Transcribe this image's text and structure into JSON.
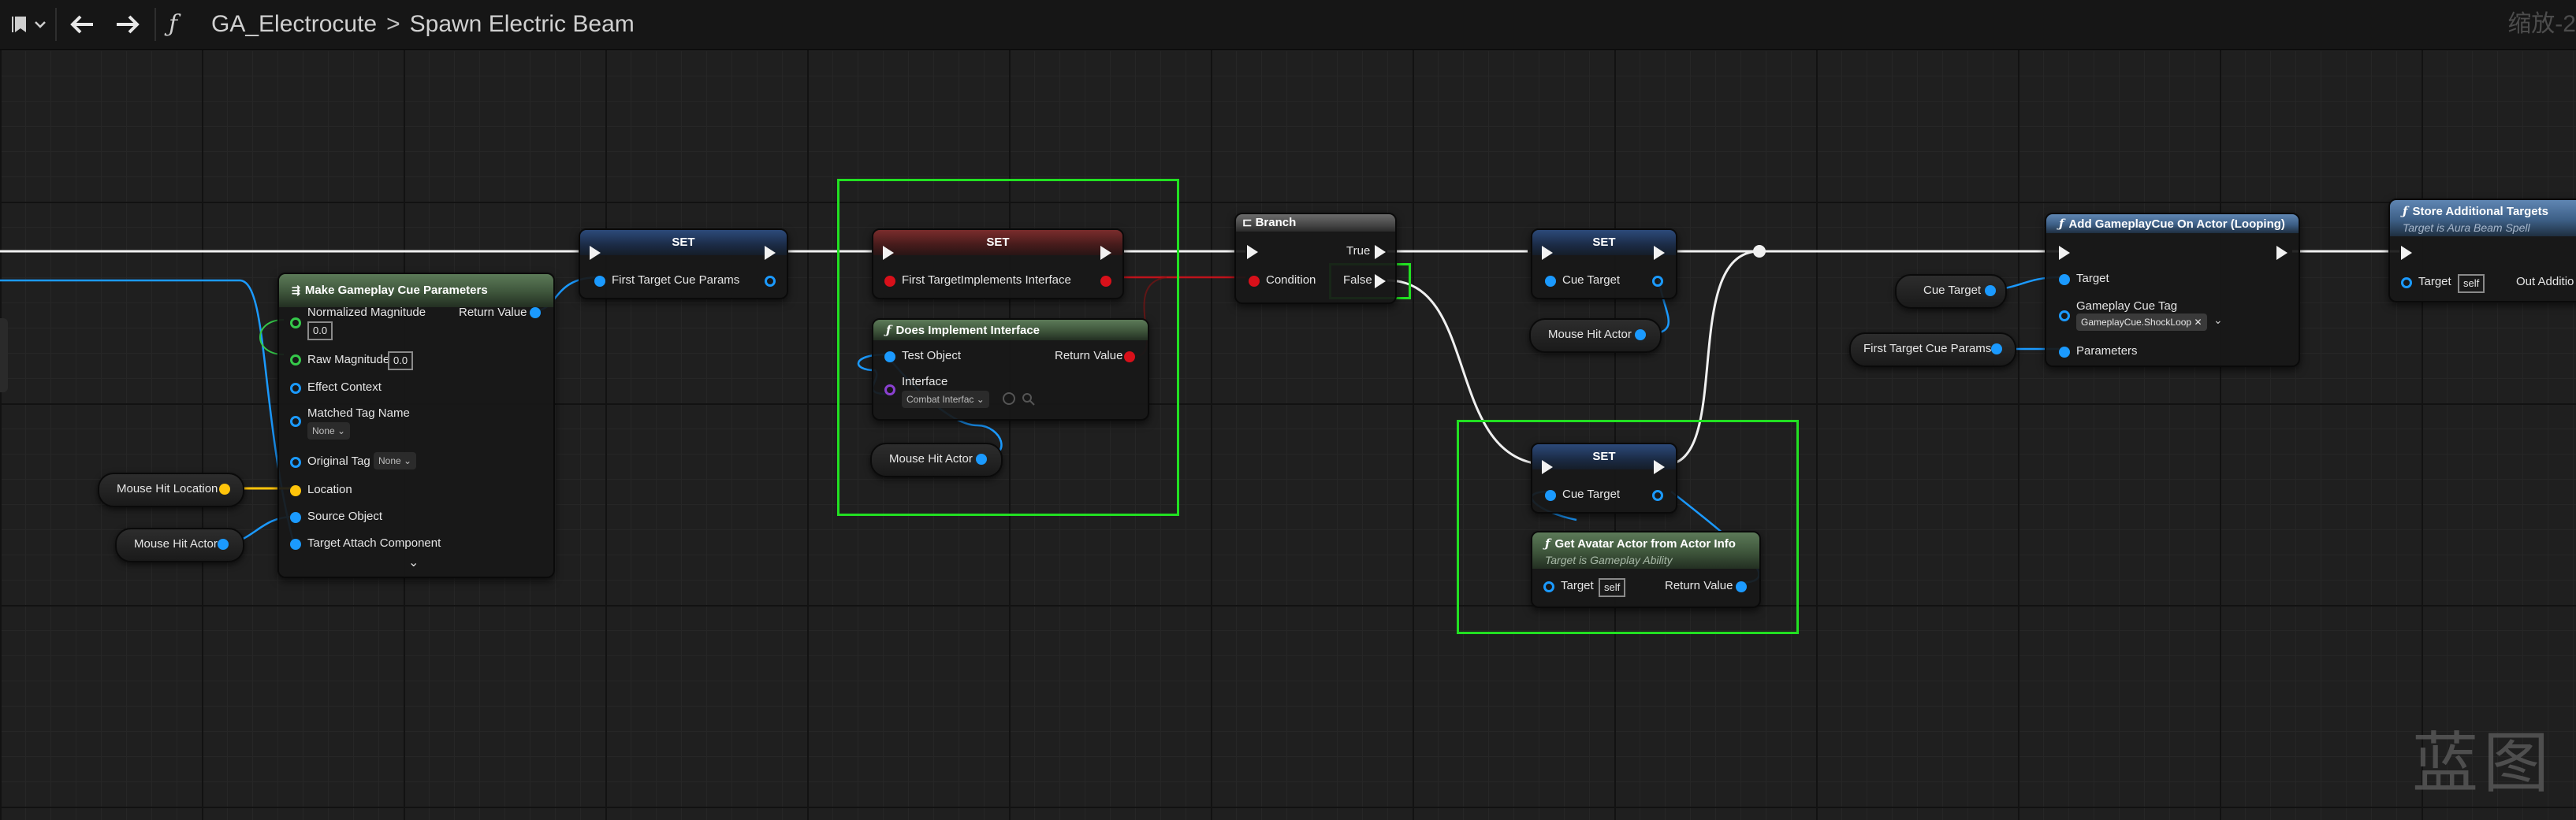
{
  "toolbar": {
    "bookmark_icon": "bookmark-icon",
    "dropdown_icon": "chevron-down-icon",
    "back_icon": "arrow-left-icon",
    "forward_icon": "arrow-right-icon",
    "function_glyph": "ƒ",
    "breadcrumb_blueprint": "GA_Electrocute",
    "breadcrumb_separator": ">",
    "breadcrumb_function": "Spawn Electric Beam",
    "zoom_label": "缩放-2"
  },
  "nodes": {
    "make_cue_params": {
      "title": "Make Gameplay Cue Parameters",
      "pins": {
        "normalized_magnitude": "Normalized Magnitude",
        "normalized_magnitude_value": "0.0",
        "return_value": "Return Value",
        "raw_magnitude": "Raw Magnitude",
        "raw_magnitude_value": "0.0",
        "effect_context": "Effect Context",
        "matched_tag_name": "Matched Tag Name",
        "matched_tag_value": "None",
        "original_tag": "Original Tag",
        "original_tag_value": "None",
        "location": "Location",
        "source_object": "Source Object",
        "target_attach": "Target Attach Component"
      }
    },
    "set_first_params": {
      "title": "SET",
      "pin": "First Target Cue Params"
    },
    "set_first_impl": {
      "title": "SET",
      "pin": "First TargetImplements Interface"
    },
    "does_impl": {
      "title": "Does Implement Interface",
      "test_object": "Test Object",
      "return_value": "Return Value",
      "interface": "Interface",
      "interface_value": "Combat Interfac"
    },
    "branch": {
      "title": "Branch",
      "true_label": "True",
      "condition": "Condition",
      "false_label": "False"
    },
    "set_cue_target_top": {
      "title": "SET",
      "pin": "Cue Target"
    },
    "set_cue_target_bottom": {
      "title": "SET",
      "pin": "Cue Target"
    },
    "get_avatar": {
      "title": "Get Avatar Actor from Actor Info",
      "subtitle": "Target is Gameplay Ability",
      "target": "Target",
      "target_value": "self",
      "return_value": "Return Value"
    },
    "add_cue": {
      "title": "Add GameplayCue On Actor (Looping)",
      "target": "Target",
      "tag_label": "Gameplay Cue Tag",
      "tag_value": "GameplayCue.ShockLoop",
      "tag_clear": "✕",
      "parameters": "Parameters"
    },
    "store_targets": {
      "title": "Store Additional Targets",
      "subtitle": "Target is Aura Beam Spell",
      "target": "Target",
      "target_value": "self",
      "out": "Out Additio"
    }
  },
  "variables": {
    "mouse_hit_location_1": "Mouse Hit Location",
    "mouse_hit_actor_1": "Mouse Hit Actor",
    "mouse_hit_actor_2": "Mouse Hit Actor",
    "mouse_hit_actor_3": "Mouse Hit Actor",
    "cue_target": "Cue Target",
    "first_target_cue_params": "First Target Cue Params"
  },
  "watermark": "蓝图",
  "colors": {
    "exec": "#f2f2f2",
    "object_pin": "#1b9aff",
    "struct_pin": "#1b9aff",
    "bool_pin": "#d8101a",
    "vector_pin": "#ffc40a",
    "float_pin": "#35c84a",
    "interface_pin": "#8a40d0",
    "selection": "#22e022",
    "function_header": "#3e553b",
    "set_header_blue": "#1b2b45",
    "set_header_red": "#451b1b"
  }
}
